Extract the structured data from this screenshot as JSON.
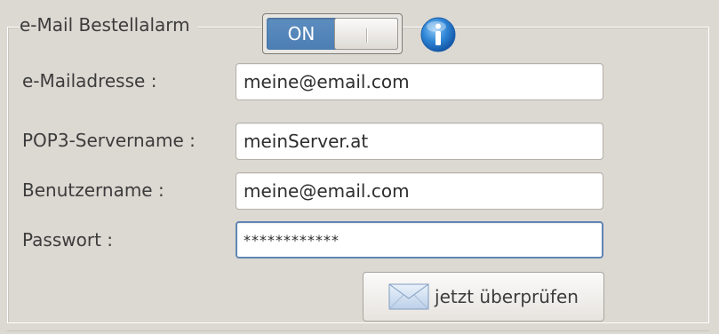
{
  "group": {
    "title": "e-Mail Bestellalarm",
    "toggle_label": "ON"
  },
  "fields": {
    "email": {
      "label": "e-Mailadresse :",
      "value": "meine@email.com"
    },
    "pop3": {
      "label": "POP3-Servername :",
      "value": "meinServer.at"
    },
    "username": {
      "label": "Benutzername :",
      "value": "meine@email.com"
    },
    "password": {
      "label": "Passwort :",
      "value": "************"
    }
  },
  "check_button": {
    "label": "jetzt überprüfen",
    "icon": "envelope-icon"
  },
  "info_icon": "info-icon",
  "colors": {
    "toggle_on": "#4f80b6",
    "focus_border": "#5f86b4",
    "info_blue": "#2a7bd0"
  }
}
